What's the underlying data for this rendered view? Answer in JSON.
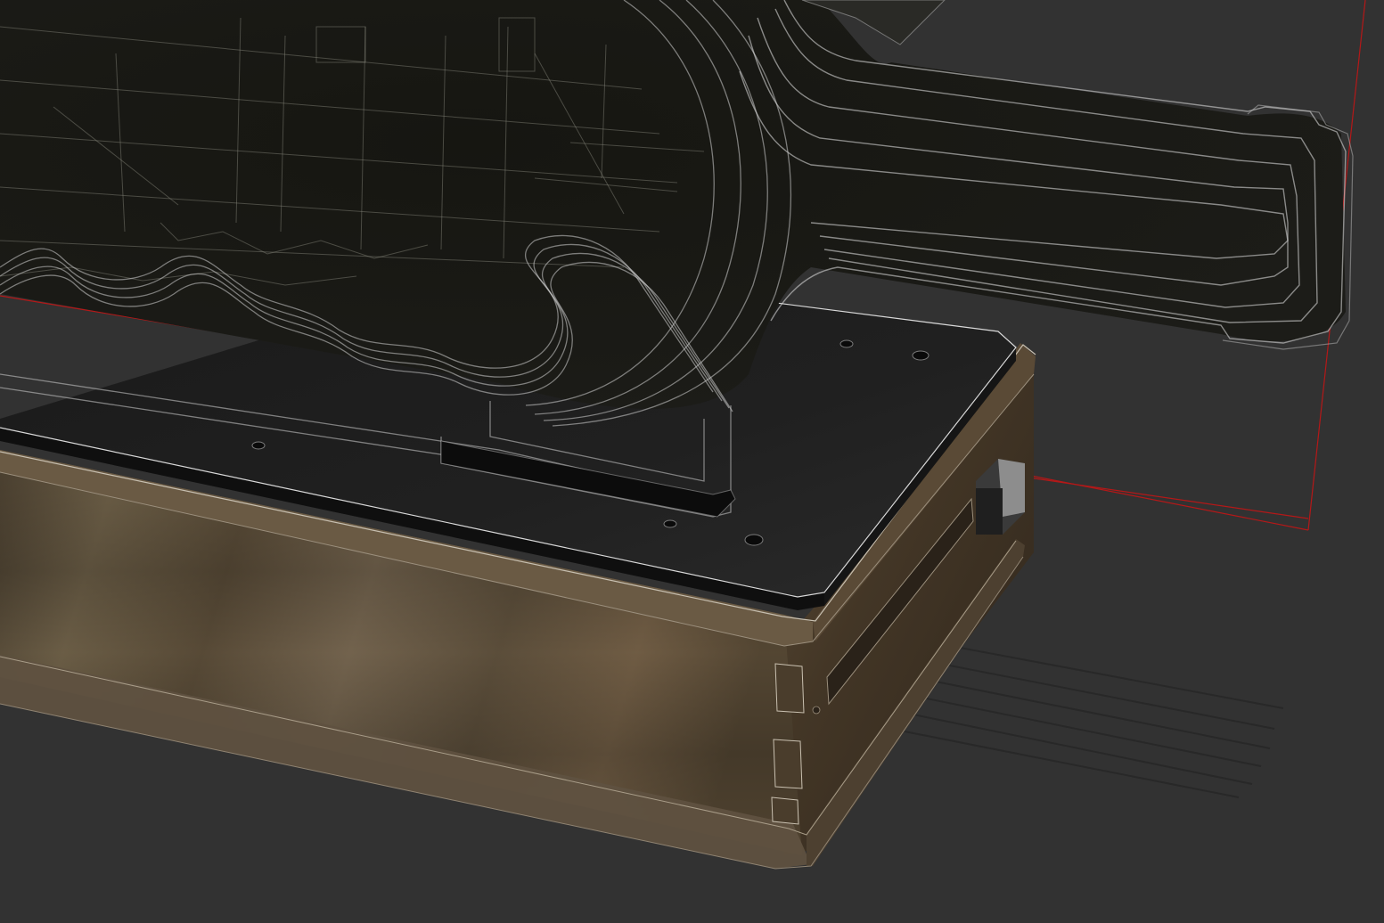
{
  "scene": {
    "colors": {
      "background": "#323232",
      "wood_light": "#6e6048",
      "wood_dark": "#3a3024",
      "plate": "#1c1c1c",
      "glass_edge": "#cfcfcf",
      "bounding_box": "#b41818"
    },
    "objects": [
      "wooden-base",
      "acrylic-plate",
      "glass-bottle",
      "ship-model",
      "wave-layers",
      "bottle-stand",
      "side-button",
      "bounding-box"
    ]
  }
}
